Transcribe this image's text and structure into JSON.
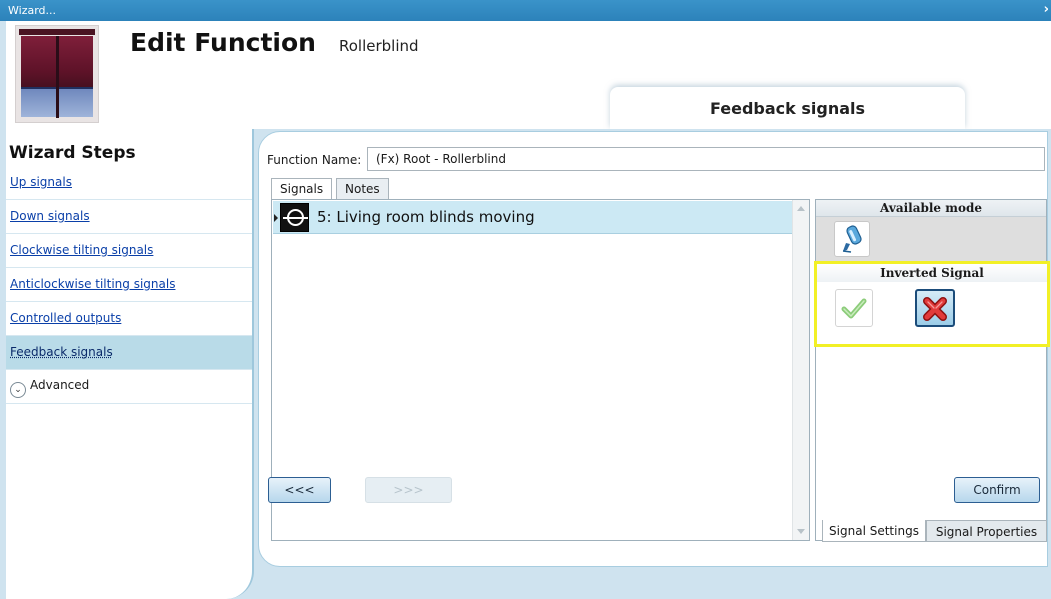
{
  "window": {
    "title": "Wizard...",
    "close_glyph": "›"
  },
  "header": {
    "icon": "rollerblind-icon",
    "title": "Edit Function",
    "subtitle": "Rollerblind",
    "section_tab": "Feedback signals"
  },
  "sidebar": {
    "title": "Wizard Steps",
    "items": [
      {
        "label": "Up signals",
        "active": false
      },
      {
        "label": "Down signals",
        "active": false
      },
      {
        "label": "Clockwise tilting signals",
        "active": false
      },
      {
        "label": "Anticlockwise tilting signals",
        "active": false
      },
      {
        "label": "Controlled outputs",
        "active": false
      },
      {
        "label": "Feedback signals",
        "active": true
      }
    ],
    "advanced_label": "Advanced",
    "advanced_glyph": "⌄"
  },
  "form": {
    "function_name_label": "Function Name:",
    "function_name_value": "(Fx) Root - Rollerblind"
  },
  "tabs": [
    {
      "label": "Signals",
      "active": true
    },
    {
      "label": "Notes",
      "active": false
    }
  ],
  "signals": [
    {
      "label": "5: Living room blinds moving",
      "icon": "feedback-signal-icon",
      "selected": true
    }
  ],
  "settings_panel": {
    "available_mode_title": "Available mode",
    "mode_icon": "sensor-probe-icon",
    "inverted_signal_title": "Inverted Signal",
    "inverted_options": [
      {
        "name": "check-icon",
        "selected": false
      },
      {
        "name": "cross-icon",
        "selected": true
      }
    ],
    "bottom_tabs": [
      {
        "label": "Signal Settings",
        "active": true
      },
      {
        "label": "Signal Properties",
        "active": false
      }
    ]
  },
  "footer": {
    "prev_label": "<<<",
    "next_label": ">>>",
    "next_enabled": false,
    "confirm_label": "Confirm"
  },
  "colors": {
    "titlebar": "#2f88c0",
    "background": "#cfe3ef",
    "selected_row": "#cce9f4",
    "highlight_border": "#f2f026",
    "link": "#0a3fa8"
  }
}
